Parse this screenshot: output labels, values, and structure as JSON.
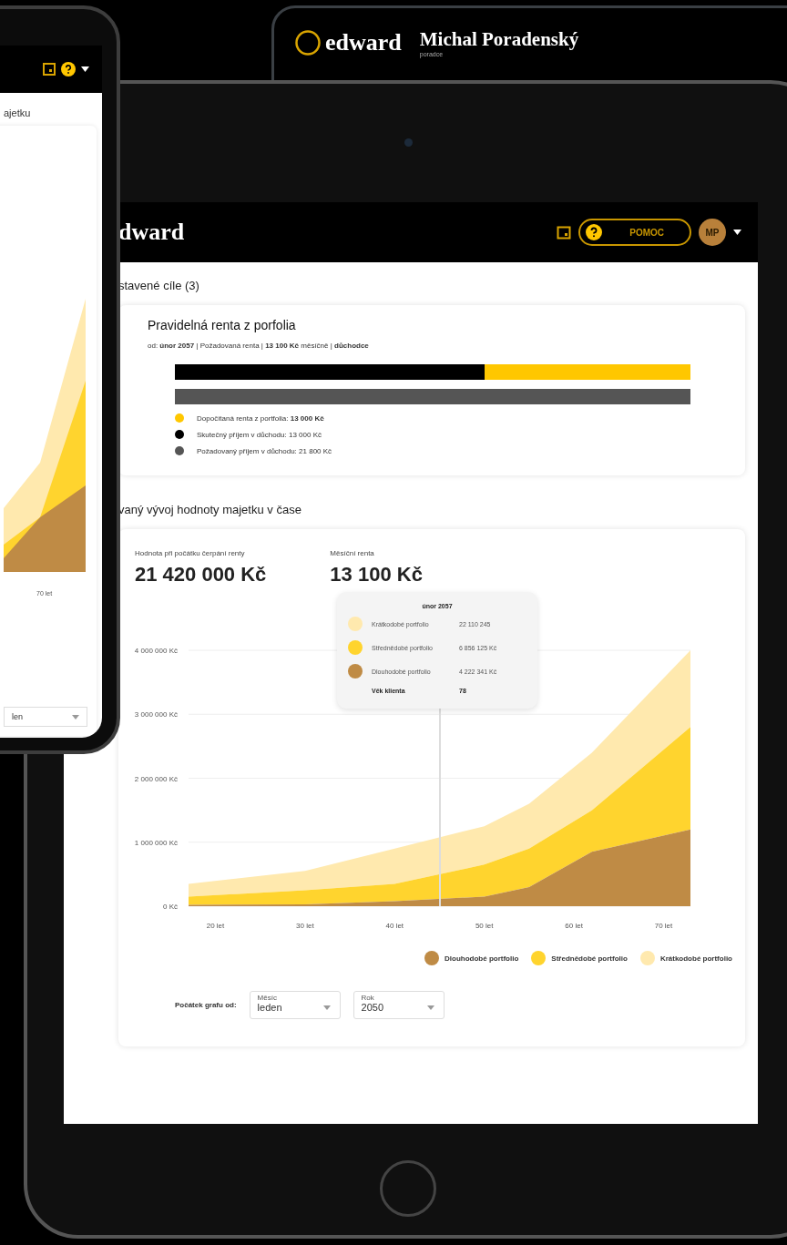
{
  "laptop": {
    "logo": "edward",
    "user_name": "Michal Poradenský",
    "user_role": "poradce"
  },
  "phone": {
    "section_title": "ajetku",
    "x_label": "70 let",
    "select_value": "len"
  },
  "tablet": {
    "logo": "dward",
    "help_button": "POMOC",
    "avatar": "MP",
    "goals_title": "stavené cíle (3)",
    "goal": {
      "title": "Pravidelná renta z porfolia",
      "subtitle": "od: **únor 2057** | Požadovaná renta | **13 100 Kč** měsíčně | **důchodce**",
      "bars": [
        {
          "kind": "split",
          "color": "#000000",
          "level": 0.6
        },
        {
          "kind": "full",
          "color": "#555555"
        }
      ],
      "legend": [
        {
          "text": "Dopočítaná renta z portfolia: **13 000 Kč**",
          "color": "#ffc700"
        },
        {
          "text": "Skutečný příjem v důchodu: 13 000 Kč",
          "color": "#000000"
        },
        {
          "text": "Požadovaný příjem v důchodu: 21 800 Kč",
          "color": "#555555"
        }
      ]
    },
    "growth_title": "vaný vývoj hodnoty majetku v čase",
    "stats": [
      {
        "label": "Hodnota při počátku čerpání renty",
        "value": "21 420 000 Kč"
      },
      {
        "label": "Měsíční renta",
        "value": "13 100 Kč"
      }
    ],
    "chart_data": {
      "type": "area",
      "stacked": true,
      "x": [
        17,
        30,
        40,
        50,
        55,
        62,
        73
      ],
      "series": [
        {
          "name": "Dlouhodobé portfolio",
          "color": "#bf8b45",
          "values": [
            20000,
            30000,
            80000,
            150000,
            300000,
            850000,
            1200000
          ]
        },
        {
          "name": "Střednědobé portfolio",
          "color": "#ffd42e",
          "values": [
            130000,
            220000,
            270000,
            500000,
            600000,
            650000,
            1600000
          ]
        },
        {
          "name": "Krátkodobé portfolio",
          "color": "#ffe9ae",
          "values": [
            200000,
            300000,
            550000,
            600000,
            700000,
            900000,
            1200000
          ]
        }
      ],
      "grid": true,
      "legend": "bottom-right",
      "xlim": [
        17,
        73
      ],
      "ylim": [
        0,
        4000000
      ],
      "xticks": [
        {
          "value": 20,
          "label": "20 let"
        },
        {
          "value": 30,
          "label": "30 let"
        },
        {
          "value": 40,
          "label": "40 let"
        },
        {
          "value": 50,
          "label": "50 let"
        },
        {
          "value": 60,
          "label": "60 let"
        },
        {
          "value": 70,
          "label": "70 let"
        }
      ],
      "yticks": [
        {
          "value": 0,
          "label": "0 Kč"
        },
        {
          "value": 1000000,
          "label": "1 000 000 Kč"
        },
        {
          "value": 2000000,
          "label": "2 000 000 Kč"
        },
        {
          "value": 3000000,
          "label": "3 000 000 Kč"
        },
        {
          "value": 4000000,
          "label": "4 000 000 Kč"
        }
      ]
    },
    "tooltip": {
      "title": "únor 2057",
      "rows": [
        {
          "label": "Krátkodobé portfolio",
          "value": "22 110 245",
          "color": "#ffe9ae"
        },
        {
          "label": "Střednědobé portfolio",
          "value": "6 856 125 Kč",
          "color": "#ffd42e"
        },
        {
          "label": "Dlouhodobé portfolio",
          "value": "4 222 341 Kč",
          "color": "#bf8b45"
        }
      ],
      "age_label": "Věk klienta",
      "age_value": "78"
    },
    "start_label": "Počátek grafu od:",
    "selects": [
      {
        "label": "Měsíc",
        "value": "leden"
      },
      {
        "label": "Rok",
        "value": "2050"
      }
    ]
  }
}
